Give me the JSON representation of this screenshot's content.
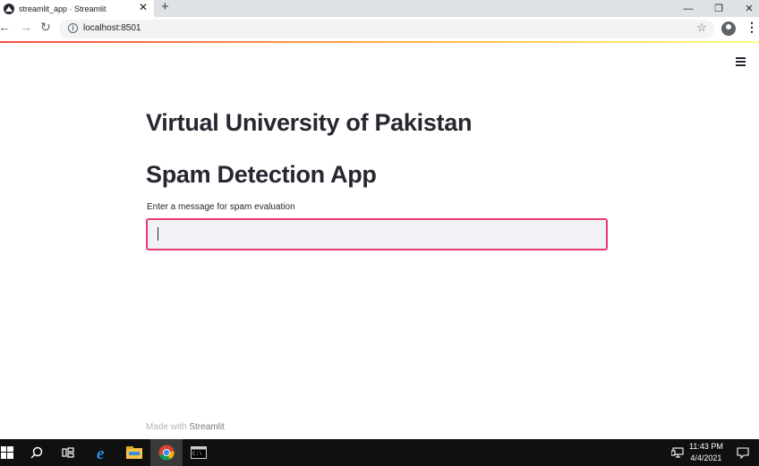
{
  "browser": {
    "tab_title": "streamlit_app · Streamlit",
    "tab_close": "✕",
    "new_tab": "+",
    "url": "localhost:8501",
    "window_controls": {
      "minimize": "—",
      "restore": "❐",
      "close": "✕"
    }
  },
  "app": {
    "heading1": "Virtual University of Pakistan",
    "heading2": "Spam Detection App",
    "input_label": "Enter a message for spam evaluation",
    "input_value": "",
    "footer_prefix": "Made with ",
    "footer_brand": "Streamlit"
  },
  "taskbar": {
    "time": "11:43 PM",
    "date": "4/4/2021"
  },
  "colors": {
    "accent": "#e8386d",
    "input_bg": "#f0f2f6",
    "text": "#262730"
  }
}
